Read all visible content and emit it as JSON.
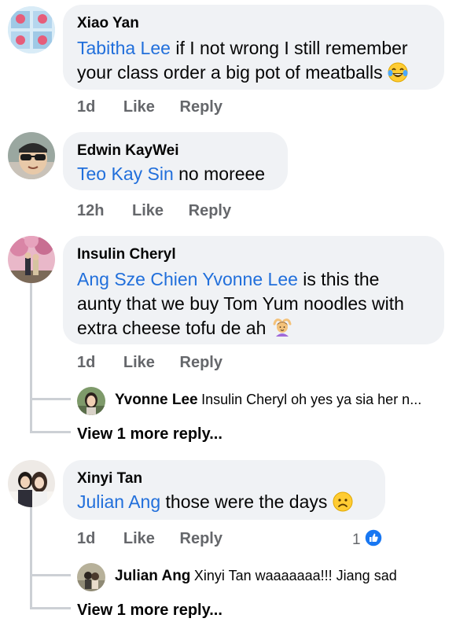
{
  "comments": [
    {
      "author": "Xiao Yan",
      "mention": "Tabitha Lee",
      "text_line1": " if I not wrong I still remember",
      "text_line2": "your class order a big pot of meatballs",
      "emoji": "tears-of-joy-emoji",
      "time": "1d",
      "like": "Like",
      "reply": "Reply"
    },
    {
      "author": "Edwin KayWei",
      "mention": "Teo Kay Sin",
      "text": " no moreee",
      "time": "12h",
      "like": "Like",
      "reply": "Reply"
    },
    {
      "author": "Insulin Cheryl",
      "mention": "Ang Sze Chien Yvonne Lee",
      "text_line1": " is this the",
      "text_line2": "aunty that we buy Tom Yum noodles with",
      "text_line3": "extra cheese tofu de ah",
      "emoji": "person-gesturing-ok-emoji",
      "time": "1d",
      "like": "Like",
      "reply": "Reply",
      "reply_preview": {
        "author": "Yvonne Lee",
        "text": "Insulin Cheryl oh yes ya sia her n..."
      },
      "view_more": "View 1 more reply..."
    },
    {
      "author": "Xinyi Tan",
      "mention": "Julian Ang",
      "text": " those were the days",
      "emoji": "frowning-face-emoji",
      "time": "1d",
      "like": "Like",
      "reply": "Reply",
      "reaction_count": "1",
      "reaction": "like-reaction-icon",
      "reply_preview": {
        "author": "Julian Ang",
        "text": "Xinyi Tan waaaaaaa!!! Jiang sad"
      },
      "view_more": "View 1 more reply..."
    }
  ],
  "colors": {
    "bubble": "#f0f2f5",
    "mention": "#216fdb",
    "meta": "#65676b",
    "like_blue": "#1877f2"
  }
}
